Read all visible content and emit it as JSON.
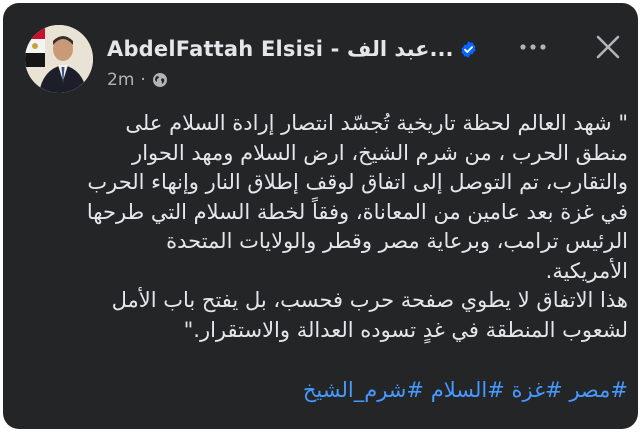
{
  "post": {
    "author": {
      "name": "AbdelFattah Elsisi - عبد الف...",
      "verified": true
    },
    "timestamp": "2m",
    "separator": "·",
    "audience_icon": "globe-icon",
    "body_lines": [
      "\" شهد العالم لحظة تاريخية تُجسّد انتصار إرادة السلام على",
      "منطق الحرب ، من شرم الشيخ، ارض السلام ومهد الحوار",
      "والتقارب، تم التوصل إلى اتفاق لوقف إطلاق النار وإنهاء الحرب",
      "في غزة بعد عامين من المعاناة، وفقاً لخطة السلام التي طرحها",
      "الرئيس ترامب، وبرعاية مصر وقطر والولايات المتحدة",
      "الأمريكية.",
      "هذا الاتفاق لا يطوي صفحة حرب فحسب، بل يفتح باب الأمل",
      "لشعوب المنطقة في غدٍ تسوده العدالة والاستقرار.\""
    ],
    "hashtags": [
      "#مصر",
      "#غزة",
      "#السلام",
      "#شرم_الشيخ"
    ]
  },
  "colors": {
    "card_bg": "#242526",
    "primary_text": "#e4e6eb",
    "secondary_text": "#b0b3b8",
    "link": "#4599ff",
    "verified_badge": "#0866ff"
  }
}
